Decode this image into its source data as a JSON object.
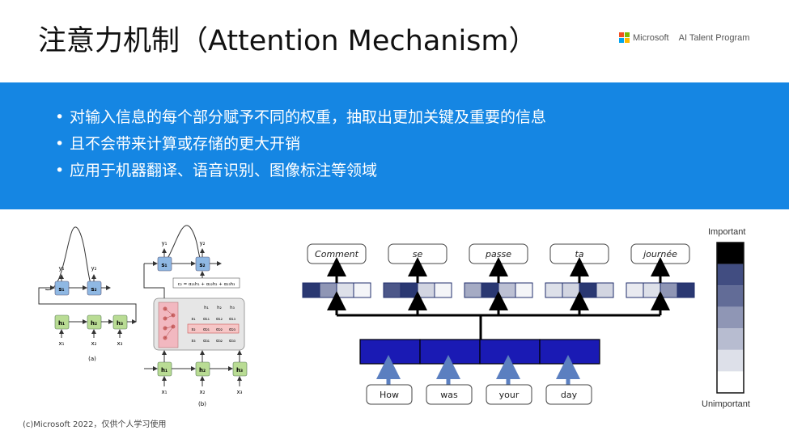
{
  "title": "注意力机制（Attention Mechanism）",
  "logo": {
    "brand": "Microsoft",
    "program": "AI Talent Program",
    "colors": [
      "#f25022",
      "#7fba00",
      "#00a4ef",
      "#ffb900"
    ]
  },
  "bullets": [
    "对输入信息的每个部分赋予不同的权重，抽取出更加关键及重要的信息",
    "且不会带来计算或存储的更大开销",
    "应用于机器翻译、语音识别、图像标注等领域"
  ],
  "footer": "(c)Microsoft 2022，仅供个人学习使用",
  "left_figure": {
    "panel_a": {
      "caption": "(a)",
      "decoder_states": [
        "s₁",
        "s₂"
      ],
      "decoder_outputs": [
        "y₁",
        "y₂"
      ],
      "encoder_states": [
        "h₁",
        "h₂",
        "h₃"
      ],
      "inputs": [
        "x₁",
        "x₂",
        "x₃"
      ]
    },
    "panel_b": {
      "caption": "(b)",
      "decoder_states": [
        "s₁",
        "s₂"
      ],
      "decoder_outputs": [
        "y₁",
        "y₂"
      ],
      "context_formula": "c₂ = α₂₁h₁ + α₂₂h₂ + α₂₃h₃",
      "matrix_header": [
        "h₁",
        "h₂",
        "h₃"
      ],
      "matrix_rows": [
        [
          "s₁",
          "α₁₁",
          "α₁₂",
          "α₁₃"
        ],
        [
          "s₂",
          "α₂₁",
          "α₂₂",
          "α₂₃"
        ],
        [
          "s₃",
          "α₃₁",
          "α₃₂",
          "α₃₃"
        ]
      ],
      "encoder_states": [
        "h₁",
        "h₂",
        "h₃"
      ],
      "inputs": [
        "x₁",
        "x₂",
        "x₃"
      ]
    }
  },
  "translation": {
    "outputs": [
      {
        "word": "Comment",
        "weights": [
          0.95,
          0.5,
          0.15,
          0.05
        ]
      },
      {
        "word": "se",
        "weights": [
          0.8,
          0.95,
          0.2,
          0.05
        ]
      },
      {
        "word": "passe",
        "weights": [
          0.4,
          0.95,
          0.3,
          0.05
        ]
      },
      {
        "word": "ta",
        "weights": [
          0.15,
          0.2,
          0.95,
          0.2
        ]
      },
      {
        "word": "journée",
        "weights": [
          0.1,
          0.15,
          0.5,
          0.95
        ]
      }
    ],
    "inputs": [
      "How",
      "was",
      "your",
      "day"
    ],
    "encoder_color": "#1a1ab4",
    "attention_base_color": "#1f2d6b"
  },
  "scale": {
    "top_label": "Important",
    "bottom_label": "Unimportant",
    "levels": [
      1.0,
      0.85,
      0.7,
      0.5,
      0.32,
      0.15,
      0.0
    ]
  }
}
